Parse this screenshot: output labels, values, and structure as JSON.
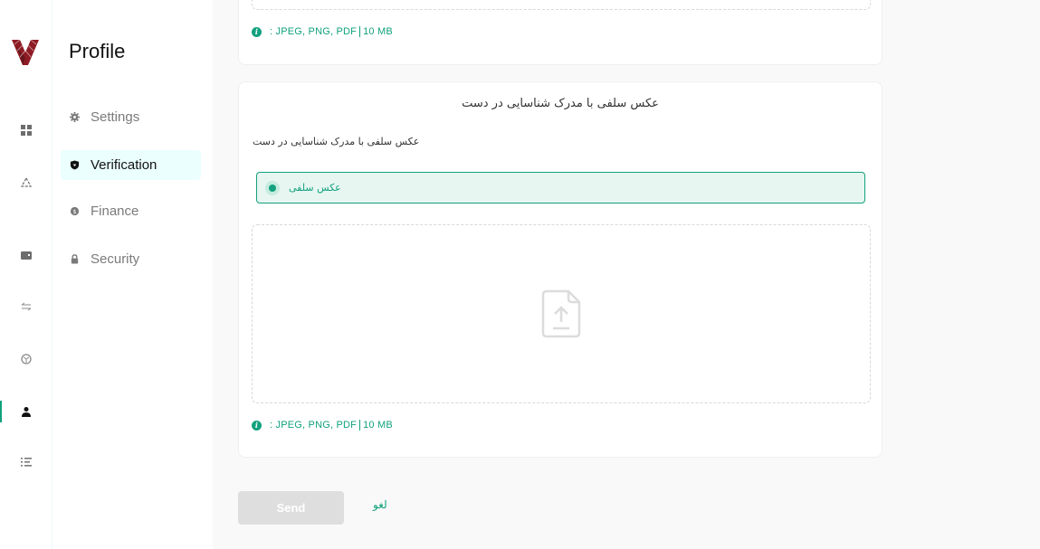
{
  "app": {
    "logo": "v-logo"
  },
  "rail": {
    "items": [
      {
        "icon": "dashboard-grid-icon",
        "active": false
      },
      {
        "icon": "recycle-triangle-icon",
        "active": false
      },
      {
        "icon": "wallet-icon",
        "active": false
      },
      {
        "icon": "exchange-arrows-icon",
        "active": false
      },
      {
        "icon": "cube-icon",
        "active": false
      },
      {
        "icon": "user-icon",
        "active": true
      },
      {
        "icon": "list-icon",
        "active": false
      }
    ]
  },
  "side": {
    "title": "Profile",
    "items": [
      {
        "label": "Settings",
        "icon": "gear-icon",
        "active": false
      },
      {
        "label": "Verification",
        "icon": "shield-icon",
        "active": true
      },
      {
        "label": "Finance",
        "icon": "dollar-coin-icon",
        "active": false
      },
      {
        "label": "Security",
        "icon": "lock-icon",
        "active": false
      }
    ]
  },
  "main": {
    "upload1": {
      "hint": ": JPEG, PNG, PDF",
      "hint_size": "10 MB"
    },
    "upload2": {
      "title": "عکس سلفی با مدرک شناسایی در دست",
      "field_label": "عکس سلفی با مدرک شناسایی در دست",
      "option_label": "عکس سلفی",
      "option_selected": true,
      "dropzone_icon": "file-upload-icon",
      "hint": ": JPEG, PNG, PDF",
      "hint_size": "10 MB"
    },
    "actions": {
      "send_label": "Send",
      "send_disabled": true,
      "cancel_label": "لغو"
    }
  },
  "colors": {
    "accent": "#12a17e",
    "active_bg": "#eafffe",
    "option_bg": "#e7f6f1",
    "disabled_btn": "#dedede",
    "logo": "#8e1c24"
  }
}
